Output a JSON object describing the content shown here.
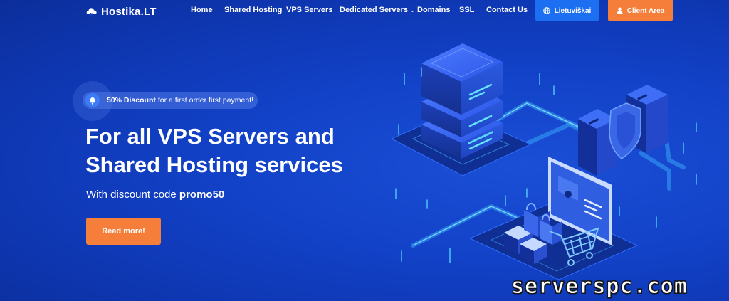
{
  "brand": {
    "name": "Hostika.LT"
  },
  "nav": {
    "items": [
      {
        "label": "Home"
      },
      {
        "label": "Shared Hosting"
      },
      {
        "label": "VPS Servers"
      },
      {
        "label": "Dedicated Servers"
      },
      {
        "label": "Domains"
      },
      {
        "label": "SSL"
      },
      {
        "label": "Contact Us"
      }
    ],
    "language_label": "Lietuviškai",
    "client_label": "Client Area"
  },
  "hero": {
    "badge_strong": "50% Discount",
    "badge_text": "for a first order first payment!",
    "title_line1": "For all VPS Servers and",
    "title_line2": "Shared Hosting services",
    "subtitle_prefix": "With discount code",
    "promo_code": "promo50",
    "cta_label": "Read more!"
  },
  "watermark": "serverspc.com",
  "colors": {
    "background": "#1242c8",
    "accent_orange": "#f57f3a",
    "accent_blue": "#1c6ff0"
  },
  "icons": [
    "cloud-logo-icon",
    "chevron-down-icon",
    "globe-icon",
    "user-icon",
    "bell-icon"
  ]
}
